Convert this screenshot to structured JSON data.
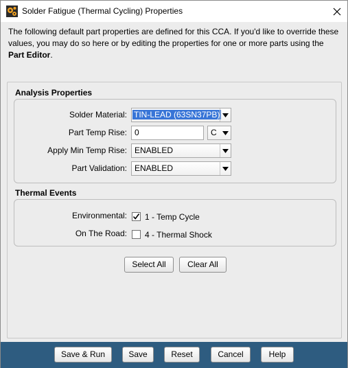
{
  "window": {
    "title": "Solder Fatigue (Thermal Cycling) Properties",
    "icon": "gear-app-icon",
    "close_icon": "close-icon"
  },
  "intro": {
    "text_before": "The following default part properties are defined for this CCA. If you'd like to override these values, you may do so here or by editing the properties for one or more parts using the ",
    "bold_text": "Part Editor",
    "text_after": "."
  },
  "analysis": {
    "title": "Analysis Properties",
    "solder_material_label": "Solder Material:",
    "solder_material_value": "TIN-LEAD (63SN37PB)",
    "part_temp_rise_label": "Part Temp Rise:",
    "part_temp_rise_value": "0",
    "temp_unit": "C",
    "apply_min_label": "Apply Min Temp Rise:",
    "apply_min_value": "ENABLED",
    "part_validation_label": "Part Validation:",
    "part_validation_value": "ENABLED"
  },
  "thermal": {
    "title": "Thermal Events",
    "environmental_label": "Environmental:",
    "environmental_item": "1 - Temp Cycle",
    "environmental_checked": true,
    "on_road_label": "On The Road:",
    "on_road_item": "4 - Thermal Shock",
    "on_road_checked": false
  },
  "buttons": {
    "select_all": "Select All",
    "clear_all": "Clear All"
  },
  "footer": {
    "save_run": "Save & Run",
    "save": "Save",
    "reset": "Reset",
    "cancel": "Cancel",
    "help": "Help",
    "background_color": "#2e5c80"
  }
}
